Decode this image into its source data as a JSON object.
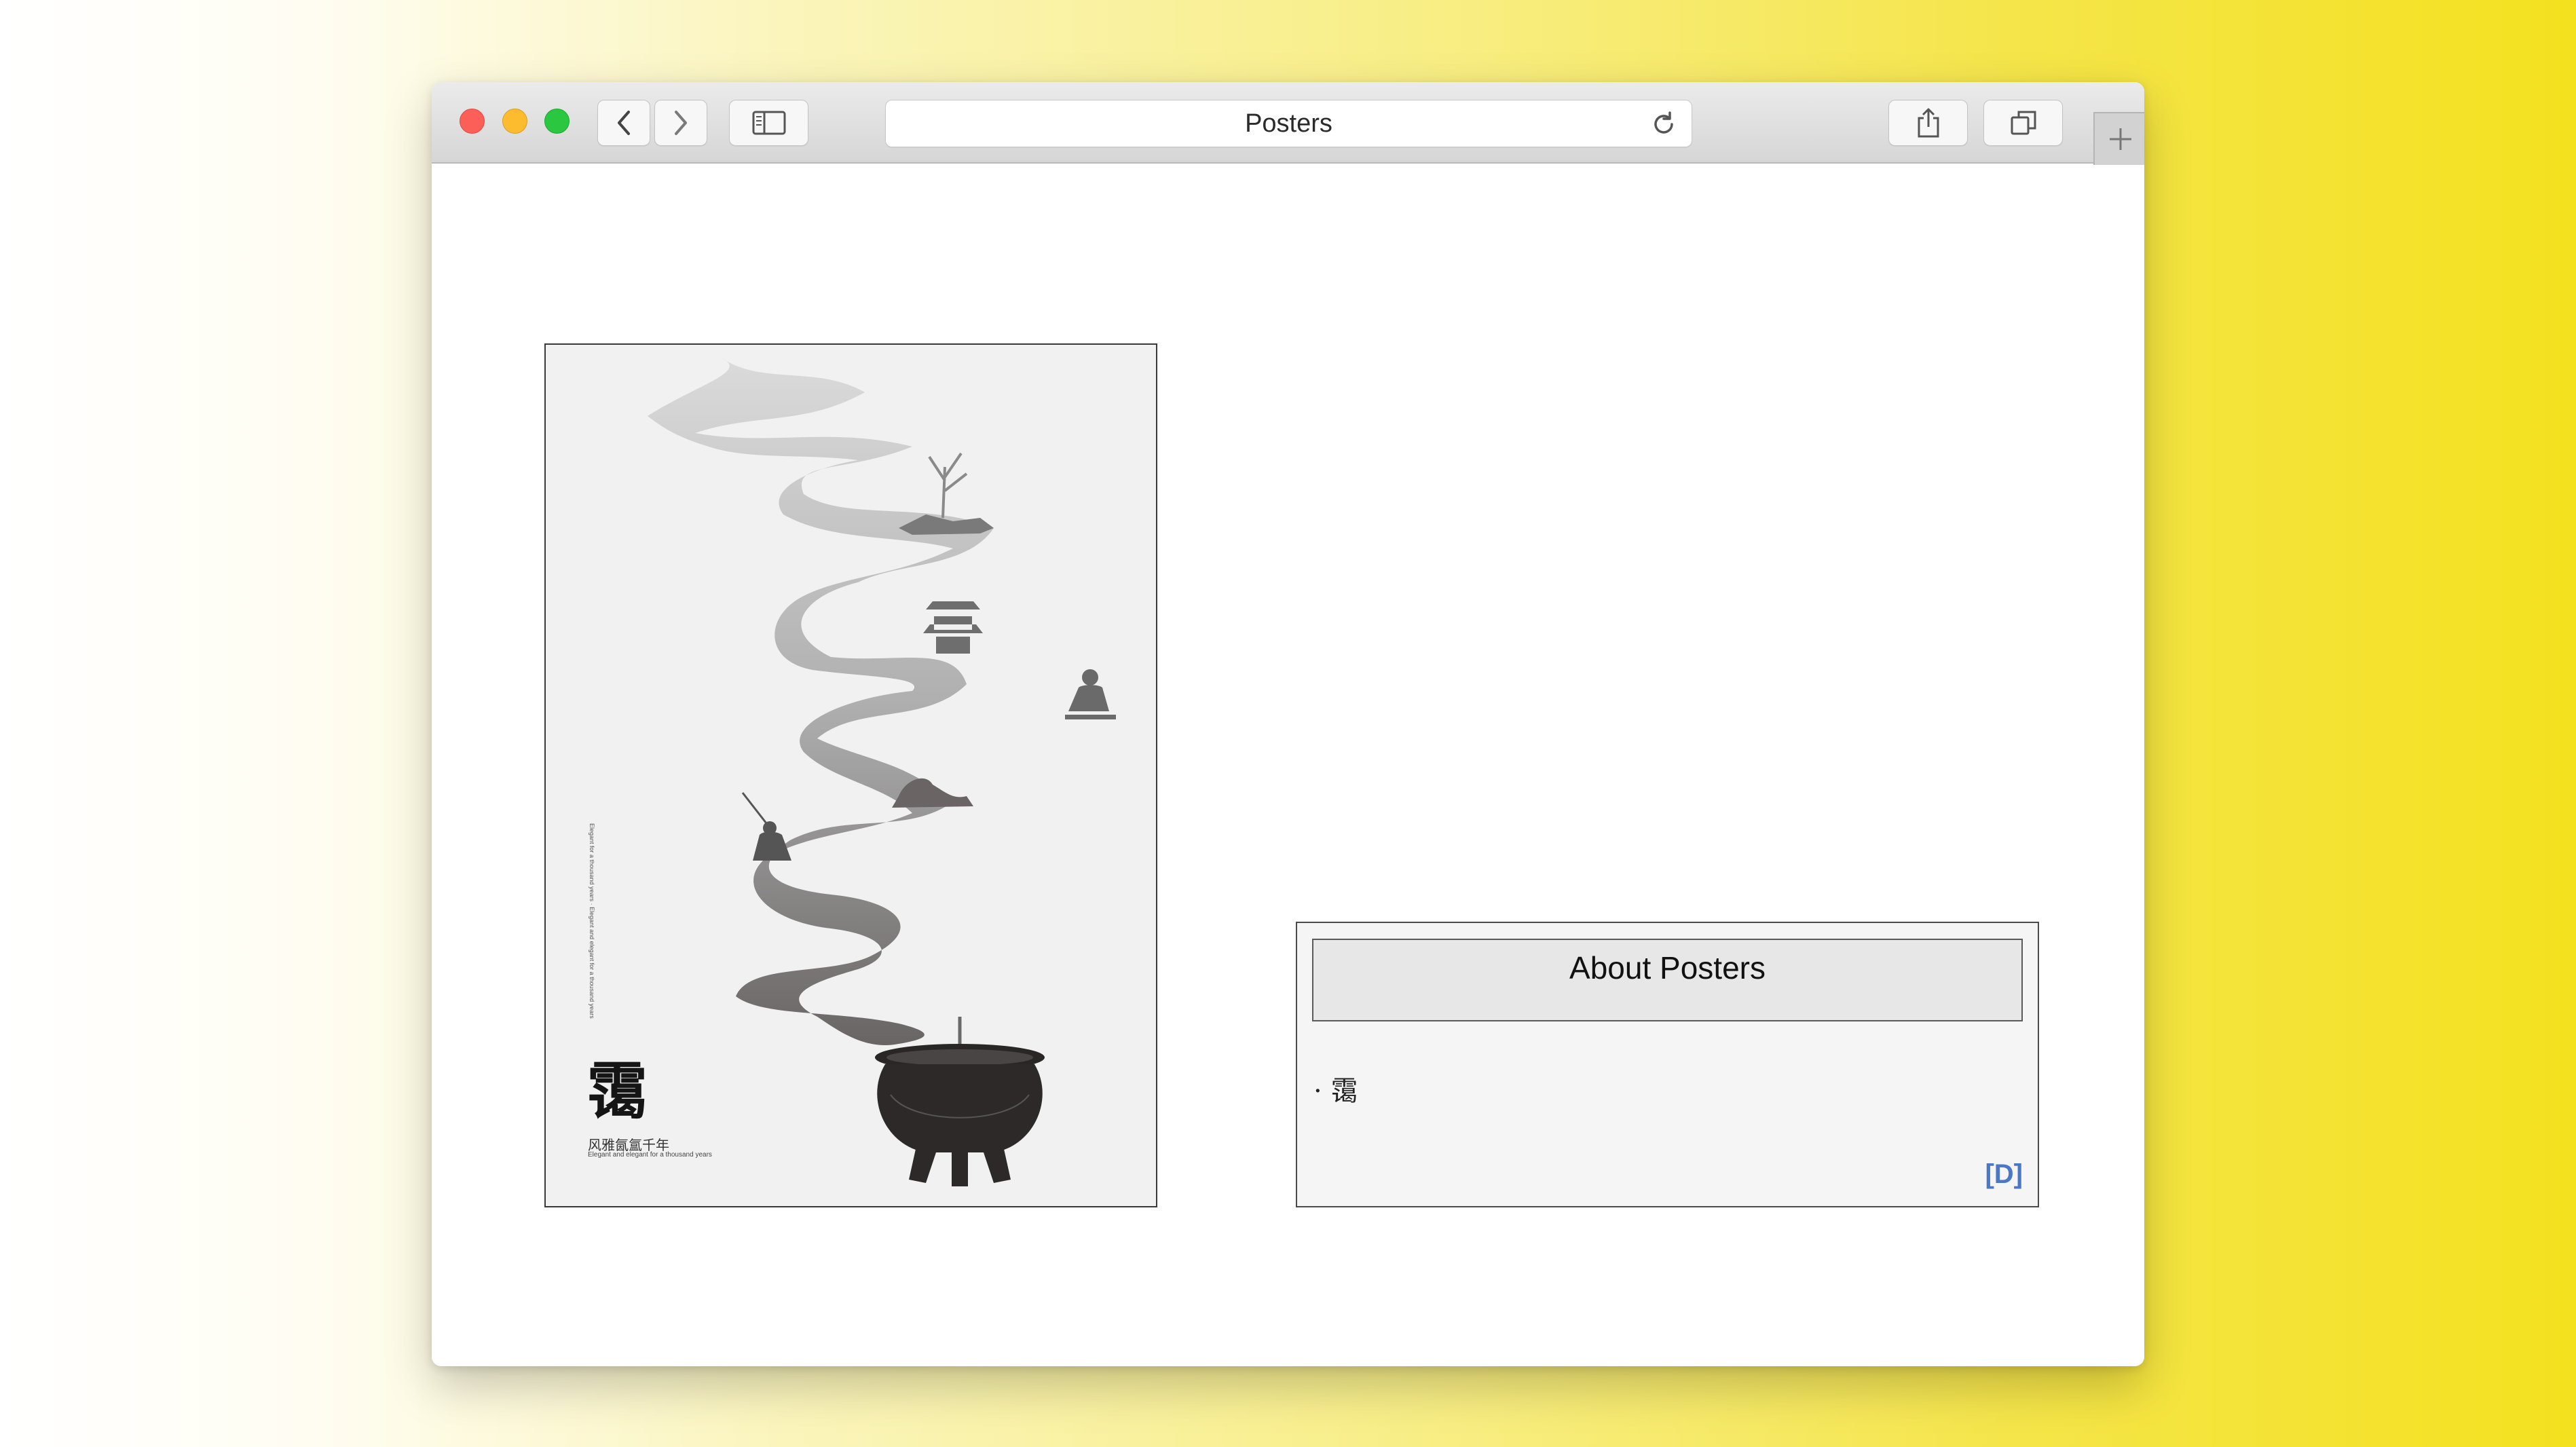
{
  "browser": {
    "title": "Posters"
  },
  "poster": {
    "character": "霭",
    "subtitle_cn": "风雅氤氲千年",
    "subtitle_en": "Elegant and elegant for a thousand years",
    "vertical_text": "Elegant for a thousand years · Elegant and elegant for a thousand years"
  },
  "about": {
    "title": "About Posters",
    "items": [
      "· 霭"
    ],
    "link_label": "[D]"
  },
  "colors": {
    "background_left": "#ffffff",
    "background_right": "#f3e11f",
    "link": "#4a78c8",
    "traffic_red": "#fc5f57",
    "traffic_yellow": "#fdbc2e",
    "traffic_green": "#29c840"
  },
  "icons": {
    "back": "chevron-left-icon",
    "forward": "chevron-right-icon",
    "sidebar": "sidebar-icon",
    "reload": "reload-icon",
    "share": "share-icon",
    "tabs": "tabs-overview-icon",
    "new_tab": "plus-icon"
  }
}
